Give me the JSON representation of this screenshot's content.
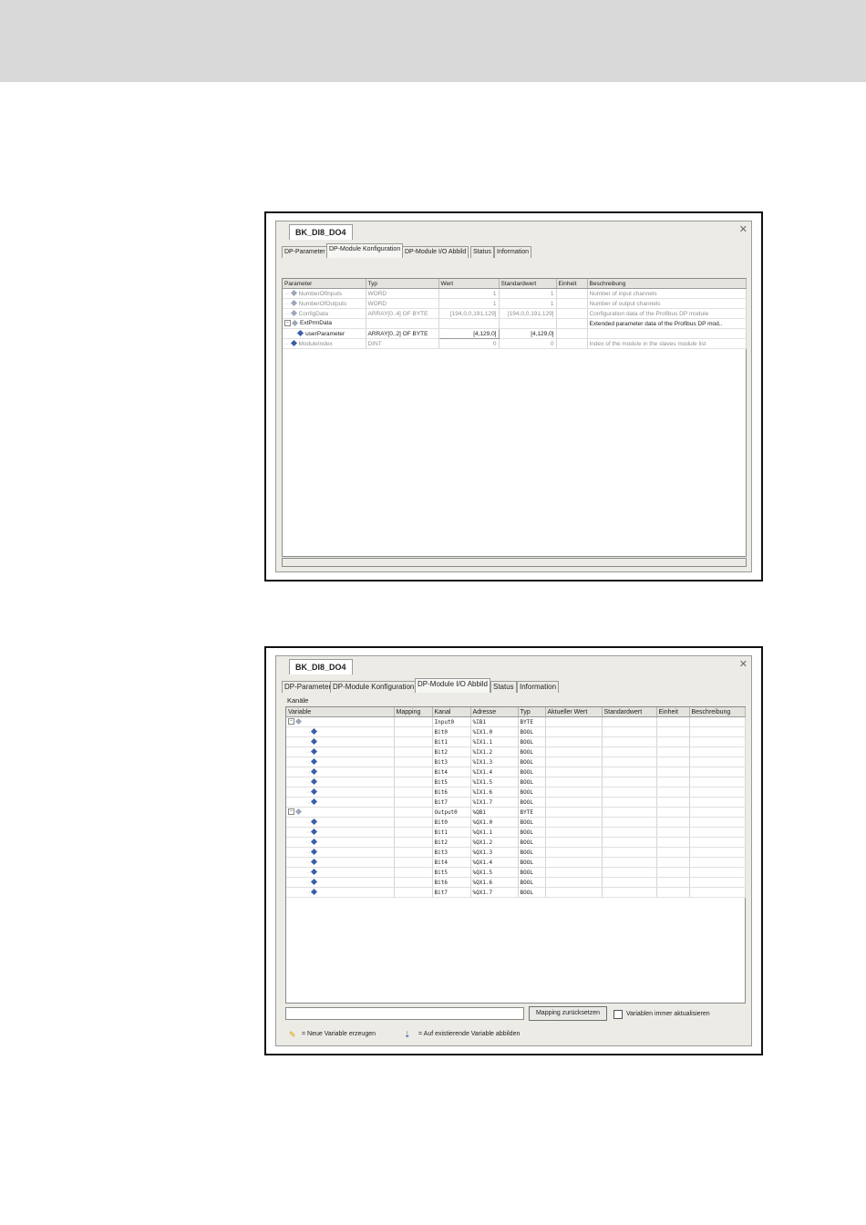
{
  "shot1": {
    "doc_tab": "BK_DI8_DO4",
    "tabs": [
      "DP-Parameter",
      "DP-Module Konfiguration",
      "DP-Module I/O Abbild",
      "Status",
      "Information"
    ],
    "columns": [
      "Parameter",
      "Typ",
      "Wert",
      "Standardwert",
      "Einheit",
      "Beschreibung"
    ],
    "rows": [
      {
        "param": "NumberOfInputs",
        "typ": "WORD",
        "wert": "1",
        "std": "1",
        "einheit": "",
        "desc": "Number of input channels"
      },
      {
        "param": "NumberOfOutputs",
        "typ": "WORD",
        "wert": "1",
        "std": "1",
        "einheit": "",
        "desc": "Number of output channels"
      },
      {
        "param": "ConfigData",
        "typ": "ARRAY[0..4] OF BYTE",
        "wert": "[194,0,0,191,129]",
        "std": "[194,0,0,191,129]",
        "einheit": "",
        "desc": "Configuration data of the Profibus DP module"
      },
      {
        "param": "ExtPrmData",
        "typ": "",
        "wert": "",
        "std": "",
        "einheit": "",
        "desc": "Extended parameter data of the Profibus DP mod.."
      },
      {
        "param": "userParameter",
        "typ": "ARRAY[0..2] OF BYTE",
        "wert": "[4,129,0]",
        "std": "[4,129,0]",
        "einheit": "",
        "desc": ""
      },
      {
        "param": "ModuleIndex",
        "typ": "DINT",
        "wert": "0",
        "std": "0",
        "einheit": "",
        "desc": "Index of the module in the slaves module list"
      }
    ]
  },
  "shot2": {
    "doc_tab": "BK_DI8_DO4",
    "tabs": [
      "DP-Parameter",
      "DP-Module Konfiguration",
      "DP-Module I/O Abbild",
      "Status",
      "Information"
    ],
    "section_label": "Kanäle",
    "columns": [
      "Variable",
      "Mapping",
      "Kanal",
      "Adresse",
      "Typ",
      "Aktueller Wert",
      "Standardwert",
      "Einheit",
      "Beschreibung"
    ],
    "rows": [
      {
        "kanal": "Input0",
        "adresse": "%IB1",
        "typ": "BYTE"
      },
      {
        "kanal": "Bit0",
        "adresse": "%IX1.0",
        "typ": "BOOL"
      },
      {
        "kanal": "Bit1",
        "adresse": "%IX1.1",
        "typ": "BOOL"
      },
      {
        "kanal": "Bit2",
        "adresse": "%IX1.2",
        "typ": "BOOL"
      },
      {
        "kanal": "Bit3",
        "adresse": "%IX1.3",
        "typ": "BOOL"
      },
      {
        "kanal": "Bit4",
        "adresse": "%IX1.4",
        "typ": "BOOL"
      },
      {
        "kanal": "Bit5",
        "adresse": "%IX1.5",
        "typ": "BOOL"
      },
      {
        "kanal": "Bit6",
        "adresse": "%IX1.6",
        "typ": "BOOL"
      },
      {
        "kanal": "Bit7",
        "adresse": "%IX1.7",
        "typ": "BOOL"
      },
      {
        "kanal": "Output0",
        "adresse": "%QB1",
        "typ": "BYTE"
      },
      {
        "kanal": "Bit0",
        "adresse": "%QX1.0",
        "typ": "BOOL"
      },
      {
        "kanal": "Bit1",
        "adresse": "%QX1.1",
        "typ": "BOOL"
      },
      {
        "kanal": "Bit2",
        "adresse": "%QX1.2",
        "typ": "BOOL"
      },
      {
        "kanal": "Bit3",
        "adresse": "%QX1.3",
        "typ": "BOOL"
      },
      {
        "kanal": "Bit4",
        "adresse": "%QX1.4",
        "typ": "BOOL"
      },
      {
        "kanal": "Bit5",
        "adresse": "%QX1.5",
        "typ": "BOOL"
      },
      {
        "kanal": "Bit6",
        "adresse": "%QX1.6",
        "typ": "BOOL"
      },
      {
        "kanal": "Bit7",
        "adresse": "%QX1.7",
        "typ": "BOOL"
      }
    ],
    "reset_button": "Mapping zurücksetzen",
    "always_update_label": "Variablen immer aktualisieren",
    "legend_new": "= Neue Variable erzeugen",
    "legend_existing": "= Auf existierende Variable abbilden"
  }
}
